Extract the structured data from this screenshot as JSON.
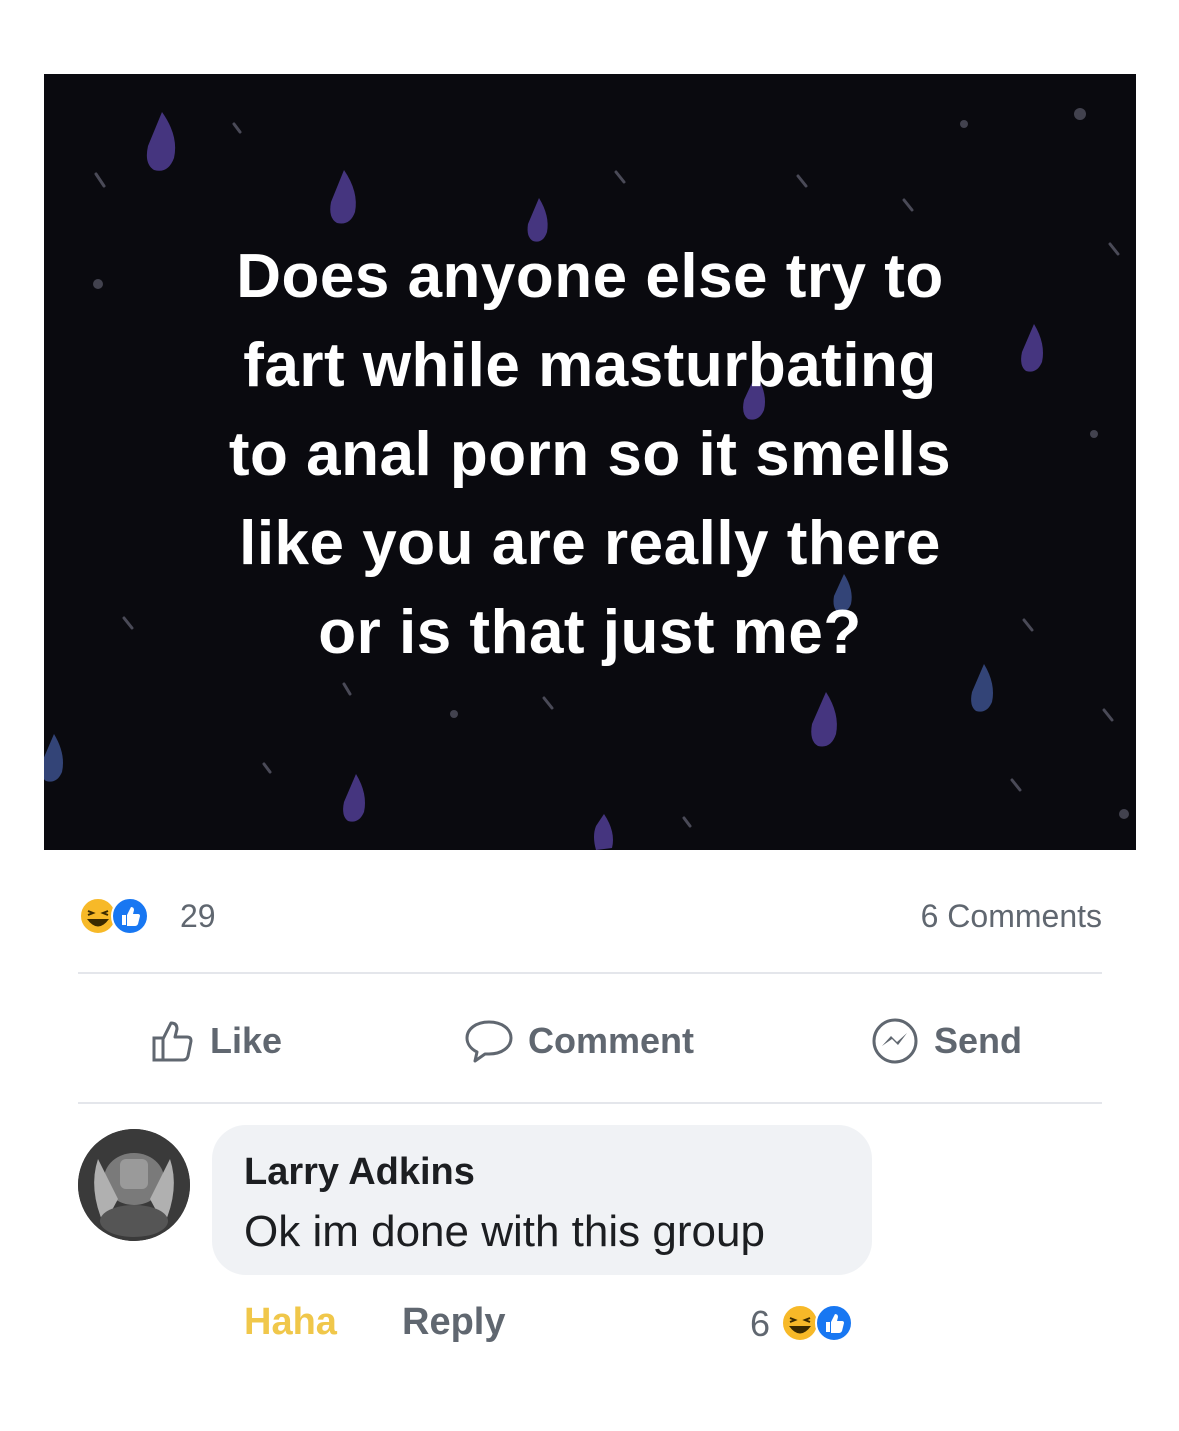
{
  "post": {
    "text": "Does anyone else try to\nfart while masturbating\nto anal porn so it smells\nlike you are really there\nor is that just me?",
    "background_color": "#0a0a0f",
    "drop_colors": [
      "#4b3a8c",
      "#3b4f8a",
      "#5a5a6a"
    ]
  },
  "stats": {
    "reaction_icons": [
      "haha-icon",
      "like-icon"
    ],
    "reaction_count": "29",
    "comments_label": "6 Comments"
  },
  "actions": {
    "like_label": "Like",
    "comment_label": "Comment",
    "send_label": "Send"
  },
  "comment": {
    "author": "Larry Adkins",
    "text": "Ok im done with this group",
    "haha_label": "Haha",
    "reply_label": "Reply",
    "reaction_count": "6",
    "reaction_icons": [
      "haha-icon",
      "like-icon"
    ]
  },
  "colors": {
    "like_blue": "#1877f2",
    "haha_yellow": "#f7b928",
    "muted_text": "#606770"
  }
}
